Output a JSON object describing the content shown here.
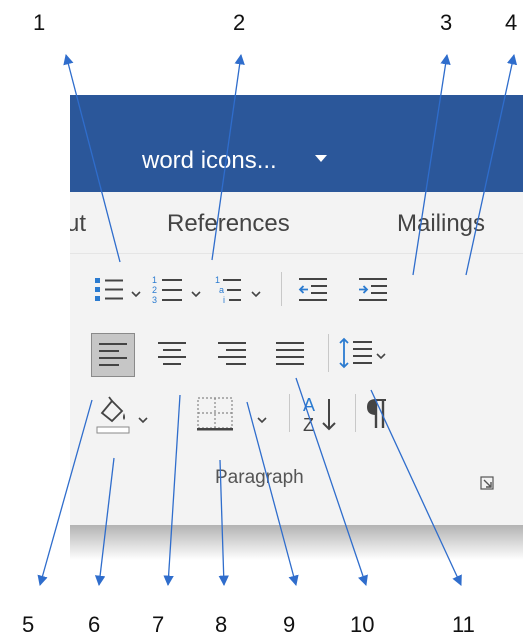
{
  "callouts": {
    "top": [
      "1",
      "2",
      "3",
      "4"
    ],
    "bottom": [
      "5",
      "6",
      "7",
      "8",
      "9",
      "10",
      "11"
    ]
  },
  "titlebar": {
    "title": "word icons...",
    "color": "#2b579a"
  },
  "tabs": [
    {
      "label": "ut"
    },
    {
      "label": "References"
    },
    {
      "label": "Mailings"
    }
  ],
  "ribbon": {
    "group_label": "Paragraph",
    "buttons": [
      {
        "name": "bullets",
        "icon": "bullets-icon",
        "has_dropdown": true
      },
      {
        "name": "numbering",
        "icon": "numbering-icon",
        "has_dropdown": true
      },
      {
        "name": "multilevel-list",
        "icon": "multilevel-list-icon",
        "has_dropdown": true
      },
      {
        "name": "decrease-indent",
        "icon": "decrease-indent-icon"
      },
      {
        "name": "increase-indent",
        "icon": "increase-indent-icon"
      },
      {
        "name": "align-left",
        "icon": "align-left-icon",
        "selected": true
      },
      {
        "name": "center",
        "icon": "align-center-icon"
      },
      {
        "name": "align-right",
        "icon": "align-right-icon"
      },
      {
        "name": "justify",
        "icon": "justify-icon"
      },
      {
        "name": "line-spacing",
        "icon": "line-spacing-icon",
        "has_dropdown": true
      },
      {
        "name": "shading",
        "icon": "paint-bucket-icon",
        "has_dropdown": true
      },
      {
        "name": "borders",
        "icon": "borders-icon",
        "has_dropdown": true
      },
      {
        "name": "sort",
        "icon": "sort-az-icon"
      },
      {
        "name": "show-hide",
        "icon": "pilcrow-icon"
      }
    ],
    "accent": "#2b7bd0"
  }
}
